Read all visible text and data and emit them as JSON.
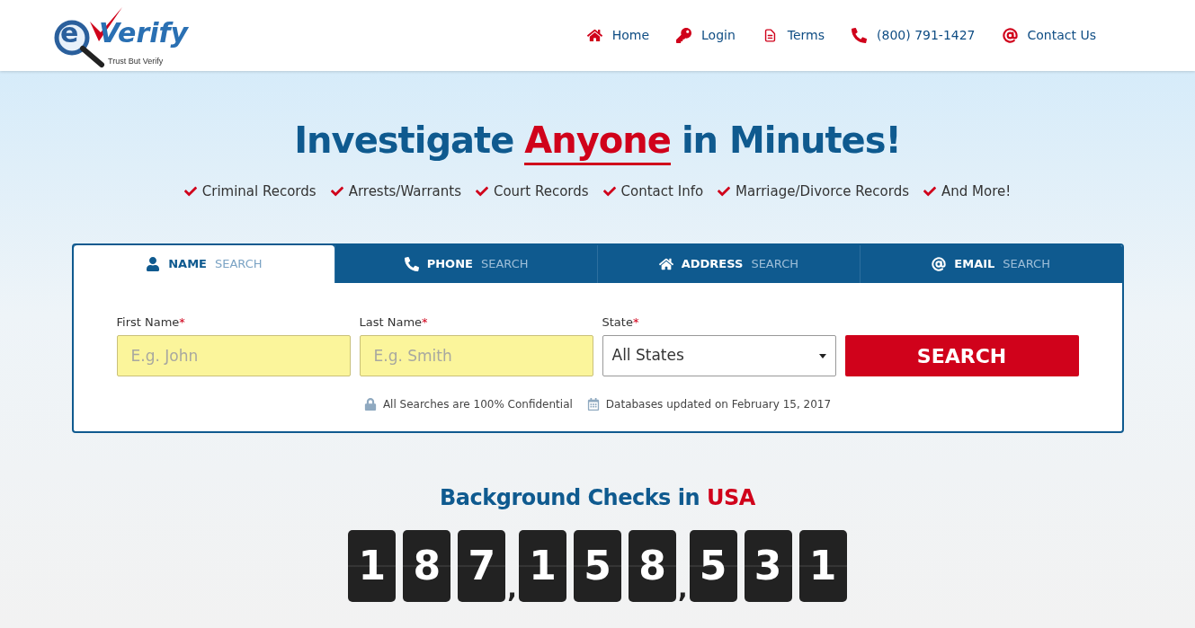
{
  "logo": {
    "letter": "e",
    "word": "Verify",
    "tagline": "Trust But Verify"
  },
  "nav": [
    {
      "label": "Home"
    },
    {
      "label": "Login"
    },
    {
      "label": "Terms"
    },
    {
      "label": "(800) 791-1427"
    },
    {
      "label": "Contact Us"
    }
  ],
  "headline": [
    {
      "text": "Investigate",
      "accent": false
    },
    {
      "text": "Anyone",
      "accent": true
    },
    {
      "text": "in Minutes!",
      "accent": false
    }
  ],
  "features": [
    "Criminal Records",
    "Arrests/Warrants",
    "Court Records",
    "Contact Info",
    "Marriage/Divorce Records",
    "And More!"
  ],
  "tabs": [
    {
      "label": "NAME",
      "suffix": "SEARCH",
      "selected": true
    },
    {
      "label": "PHONE",
      "suffix": "SEARCH",
      "selected": false
    },
    {
      "label": "ADDRESS",
      "suffix": "SEARCH",
      "selected": false
    },
    {
      "label": "EMAIL",
      "suffix": "SEARCH",
      "selected": false
    }
  ],
  "form": {
    "fields": [
      {
        "kind": "text",
        "label": "First Name",
        "required": "*",
        "placeholder": "E.g. John"
      },
      {
        "kind": "text",
        "label": "Last Name",
        "required": "*",
        "placeholder": "E.g. Smith"
      },
      {
        "kind": "select",
        "label": "State",
        "required": "*",
        "value": "All States"
      }
    ],
    "button": "SEARCH",
    "notes": [
      "All Searches are 100% Confidential",
      "Databases updated on February 15, 2017"
    ]
  },
  "counter": {
    "title": [
      {
        "text": "Background Checks in",
        "accent": false
      },
      {
        "text": "USA",
        "accent": true
      }
    ],
    "digits": [
      "1",
      "8",
      "7",
      ",",
      "1",
      "5",
      "8",
      ",",
      "5",
      "3",
      "1"
    ]
  }
}
